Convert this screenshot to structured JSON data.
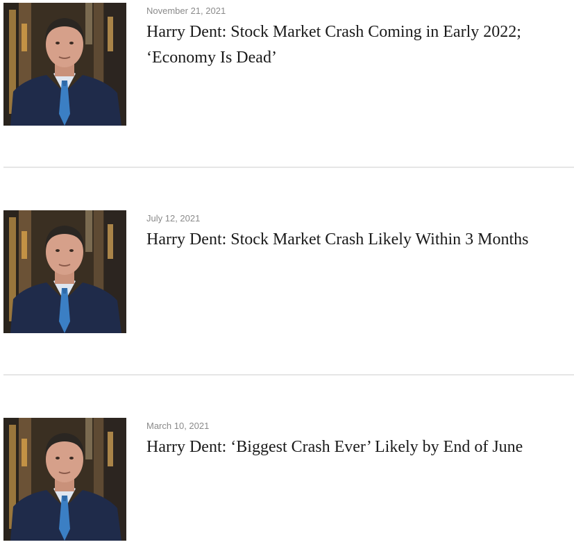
{
  "articles": [
    {
      "date": "November 21, 2021",
      "title": "Harry Dent: Stock Market Crash Coming in Early 2022; ‘Economy Is Dead’"
    },
    {
      "date": "July 12, 2021",
      "title": "Harry Dent: Stock Market Crash Likely Within 3 Months"
    },
    {
      "date": "March 10, 2021",
      "title": "Harry Dent: ‘Biggest Crash Ever’ Likely by End of June"
    }
  ],
  "colors": {
    "date_text": "#8a8a8a",
    "title_text": "#1a1a1a",
    "divider": "#e6e6e6",
    "suit": "#1f2b4a",
    "tie": "#3b7fc4"
  }
}
